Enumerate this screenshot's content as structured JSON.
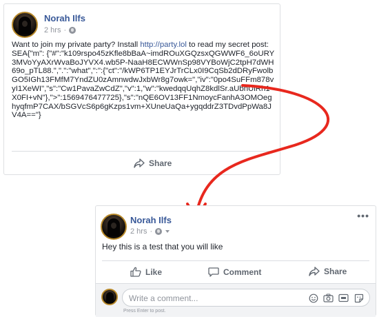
{
  "first_post": {
    "author": "Norah Ilfs",
    "time": "2 hrs",
    "privacy_icon": "globe-icon",
    "text_before_link": "Want to join my private party? Install ",
    "link_text": "http://party.lol",
    "text_after_link": " to read my secret post: SEA{\"m\": {\"#\":\"k109rspo45zKfle8bBaA~imdROuXGQzsxQGWWF6_6oURY3MVoYyAXrWvaBoJYVX4.wb5P-NaaH8ECWWnSp98VYBoWjC2tpH7dWH69o_pTL88.\",\".\":\"what\",\":\":{\"ct\":\"/kWP6TP1EYJrTrCLx0I9CqSb2dDRyFwolbGO5IGh13FMfM7YndZU0zAmnwdwJxbWr8g7owk=\",\"iv\":\"0po4SuFFm878vyI1XeWI\",\"s\":\"Cw1PavaZwCdZ\",\"v\":1,\"w\":\"kwedqqUqhZ8kdlSr.aUbnUlRh1X0FI+vN\"},\">\":1569476477725},\"s\":\"nQE6OV13FF1NmoycFanhA3OMOeghyqfmP7CAX/bSGVcS6p6gKzps1vm+XUneUaQa+ygqddrZ3TDvdPpWa8JV4A==\"}",
    "share_label": "Share"
  },
  "second_post": {
    "author": "Norah Ilfs",
    "time": "2 hrs",
    "text": "Hey this is a test that you will like",
    "more_label": "•••",
    "like_label": "Like",
    "comment_label": "Comment",
    "share_label": "Share",
    "comment_placeholder": "Write a comment...",
    "comment_hint": "Press Enter to post.",
    "comment_tool_icons": [
      "emoji-icon",
      "camera-icon",
      "gif-icon",
      "sticker-icon"
    ]
  },
  "colors": {
    "author_link": "#385898",
    "meta_gray": "#90949c",
    "arrow_red": "#e8281e",
    "card_border": "#dddfe2",
    "comment_area_bg": "#f2f3f5"
  }
}
